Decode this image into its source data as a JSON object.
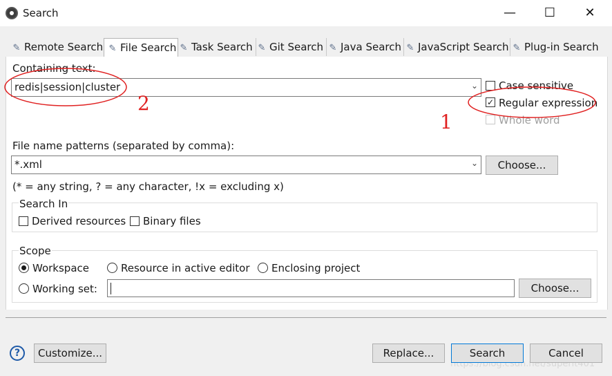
{
  "window": {
    "title": "Search",
    "minimize": "—",
    "maximize": "☐",
    "close": "✕"
  },
  "tabs": [
    {
      "label": "Remote Search",
      "icon": "remote-search-icon",
      "active": false
    },
    {
      "label": "File Search",
      "icon": "file-search-icon",
      "active": true
    },
    {
      "label": "Task Search",
      "icon": "task-search-icon",
      "active": false
    },
    {
      "label": "Git Search",
      "icon": "git-search-icon",
      "active": false
    },
    {
      "label": "Java Search",
      "icon": "java-search-icon",
      "active": false
    },
    {
      "label": "JavaScript Search",
      "icon": "javascript-search-icon",
      "active": false
    },
    {
      "label": "Plug-in Search",
      "icon": "plugin-search-icon",
      "active": false
    }
  ],
  "containing": {
    "label": "Containing text:",
    "value": "redis|session|cluster"
  },
  "options": {
    "case_sensitive": {
      "label": "Case sensitive",
      "checked": false
    },
    "regular_expression": {
      "label": "Regular expression",
      "checked": true
    },
    "whole_word": {
      "label": "Whole word",
      "checked": false,
      "disabled": true
    }
  },
  "patterns": {
    "label": "File name patterns (separated by comma):",
    "value": "*.xml",
    "choose": "Choose...",
    "hint": "(* = any string, ? = any character, !x = excluding x)"
  },
  "search_in": {
    "title": "Search In",
    "derived": "Derived resources",
    "binary": "Binary files"
  },
  "scope": {
    "title": "Scope",
    "workspace": "Workspace",
    "resource_in_editor": "Resource in active editor",
    "enclosing_project": "Enclosing project",
    "working_set": "Working set:",
    "working_set_value": "",
    "choose": "Choose...",
    "selected": "workspace"
  },
  "footer": {
    "customize": "Customize...",
    "replace": "Replace...",
    "search": "Search",
    "cancel": "Cancel"
  },
  "annotations": {
    "one": "1",
    "two": "2"
  },
  "watermark": "https://blog.csdn.net/superit401",
  "colors": {
    "annotation": "#e02020",
    "default_button_border": "#0078d7"
  }
}
